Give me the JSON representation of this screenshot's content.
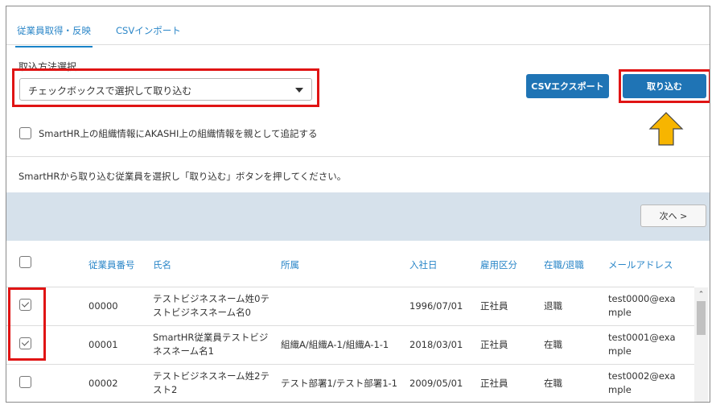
{
  "tabs": [
    {
      "label": "従業員取得・反映",
      "active": true
    },
    {
      "label": "CSVインポート",
      "active": false
    }
  ],
  "method": {
    "label": "取込方法選択",
    "selected": "チェックボックスで選択して取り込む"
  },
  "buttons": {
    "csv_export": "CSVエクスポート",
    "import": "取り込む",
    "next": "次へ >"
  },
  "append_option": {
    "label": "SmartHR上の組織情報にAKASHI上の組織情報を親として追記する",
    "checked": false
  },
  "instruction": "SmartHRから取り込む従業員を選択し「取り込む」ボタンを押してください。",
  "table": {
    "headers": [
      "従業員番号",
      "氏名",
      "所属",
      "入社日",
      "雇用区分",
      "在職/退職",
      "メールアドレス"
    ],
    "rows": [
      {
        "checked": true,
        "id": "00000",
        "name": [
          "テストビジネスネーム姓0テ",
          "ストビジネスネーム名0"
        ],
        "dept": "",
        "hired": "1996/07/01",
        "type": "正社員",
        "status": "退職",
        "email": [
          "test0000@exa",
          "mple"
        ]
      },
      {
        "checked": true,
        "id": "00001",
        "name": [
          "SmartHR従業員テストビジ",
          "ネスネーム名1"
        ],
        "dept": "組織A/組織A-1/組織A-1-1",
        "hired": "2018/03/01",
        "type": "正社員",
        "status": "在職",
        "email": [
          "test0001@exa",
          "mple"
        ]
      },
      {
        "checked": false,
        "id": "00002",
        "name": [
          "テストビジネスネーム姓2テ",
          "スト2"
        ],
        "dept": "テスト部署1/テスト部署1-1",
        "hired": "2009/05/01",
        "type": "正社員",
        "status": "在職",
        "email": [
          "test0002@exa",
          "mple"
        ]
      }
    ]
  },
  "colors": {
    "accent": "#1f74b5",
    "highlight": "#e01414",
    "arrow": "#f7b500"
  }
}
